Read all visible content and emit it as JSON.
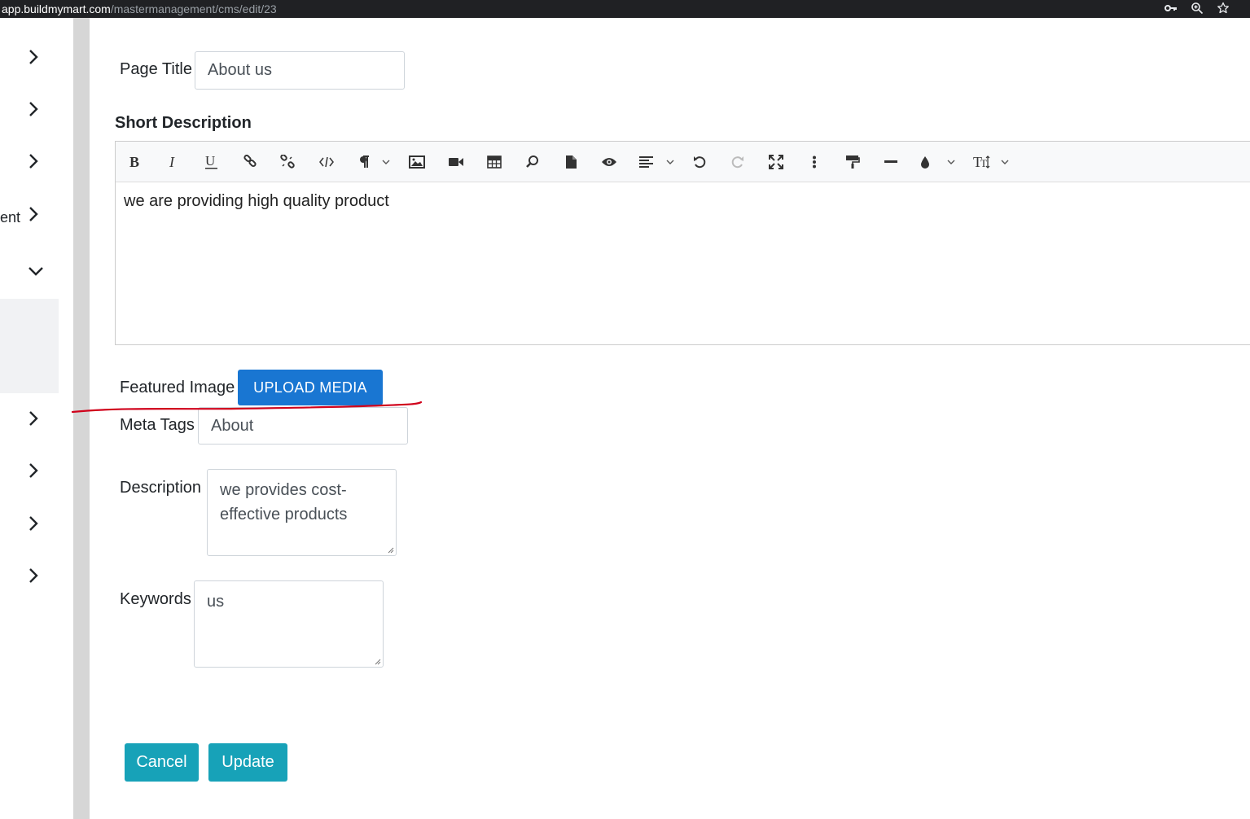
{
  "browser": {
    "url_host": "app.buildmymart.com",
    "url_path": "/mastermanagement/cms/edit/23",
    "icons": [
      "key-icon",
      "zoom-icon",
      "star-icon"
    ]
  },
  "sidebar": {
    "partial_label": "ent",
    "items": [
      {
        "icon": "chevron-right-icon"
      },
      {
        "icon": "chevron-right-icon"
      },
      {
        "icon": "chevron-right-icon"
      },
      {
        "icon": "chevron-right-icon",
        "label": "ent"
      },
      {
        "icon": "chevron-down-icon"
      },
      {
        "icon": "chevron-right-icon"
      },
      {
        "icon": "chevron-right-icon"
      },
      {
        "icon": "chevron-right-icon"
      },
      {
        "icon": "chevron-right-icon"
      }
    ]
  },
  "form": {
    "page_title_label": "Page Title",
    "page_title_value": "About us",
    "short_description_label": "Short Description",
    "short_description_value": "we are providing high quality product",
    "featured_image_label": "Featured Image",
    "upload_button": "UPLOAD MEDIA",
    "meta_tags_label": "Meta Tags",
    "meta_tags_value": "About",
    "description_label": "Description",
    "description_value": "we provides cost-effective products",
    "keywords_label": "Keywords",
    "keywords_value": "us",
    "cancel_button": "Cancel",
    "update_button": "Update"
  },
  "toolbar": {
    "buttons": [
      "bold-icon",
      "italic-icon",
      "underline-icon",
      "link-icon",
      "unlink-icon",
      "code-icon",
      "paragraph-icon",
      "image-icon",
      "video-icon",
      "table-icon",
      "search-icon",
      "file-icon",
      "preview-icon",
      "align-icon",
      "undo-icon",
      "redo-icon",
      "fullscreen-icon",
      "more-icon",
      "format-painter-icon",
      "horizontal-rule-icon",
      "color-icon",
      "font-size-icon"
    ]
  },
  "colors": {
    "upload_button": "#1976d2",
    "action_buttons": "#17a2b8",
    "annotation": "#d0021b"
  }
}
